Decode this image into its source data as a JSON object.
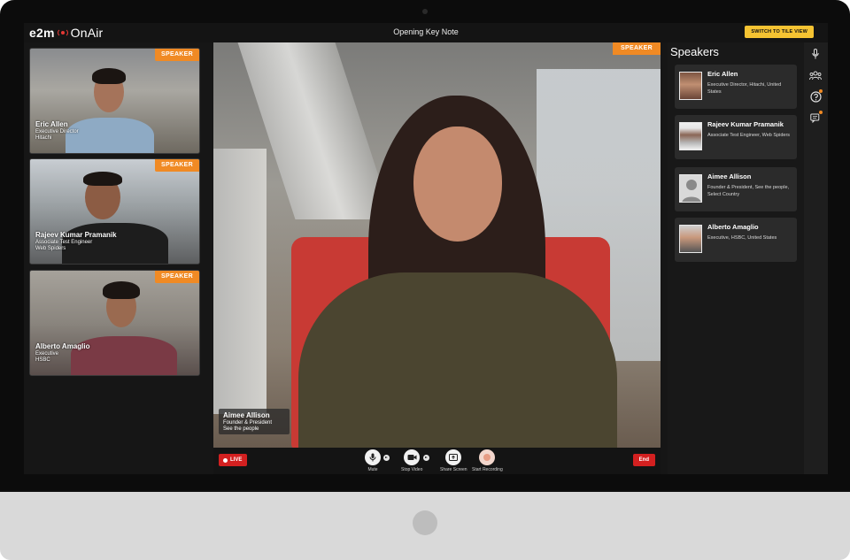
{
  "app": {
    "logo_text": "e2m",
    "logo_suffix": "OnAir",
    "meeting_title": "Opening Key Note",
    "tile_view_button": "SWITCH TO TILE VIEW"
  },
  "tiles": [
    {
      "tag": "SPEAKER",
      "name": "Eric Allen",
      "role": "Executive Director",
      "company": "Hitachi"
    },
    {
      "tag": "SPEAKER",
      "name": "Rajeev Kumar Pramanik",
      "role": "Associate Test Engineer",
      "company": "Web Spiders"
    },
    {
      "tag": "SPEAKER",
      "name": "Alberto Amaglio",
      "role": "Executive",
      "company": "HSBC"
    }
  ],
  "main": {
    "tag": "SPEAKER",
    "name": "Aimee Allison",
    "role": "Founder & President",
    "company": "See the people"
  },
  "controls": {
    "live": "LIVE",
    "mute": "Mute",
    "stop_video": "Stop Video",
    "share_screen": "Share Screen",
    "start_recording": "Start Recording",
    "end": "End"
  },
  "speakers_panel": {
    "title": "Speakers",
    "items": [
      {
        "name": "Eric Allen",
        "detail": "Executive Director, Hitachi, United States"
      },
      {
        "name": "Rajeev Kumar Pramanik",
        "detail": "Associate Test Engineer, Web Spiders"
      },
      {
        "name": "Aimee Allison",
        "detail": "Founder & President, See the people, Select Country"
      },
      {
        "name": "Alberto Amaglio",
        "detail": "Executive, HSBC, United States"
      }
    ]
  },
  "colors": {
    "speaker_tag": "#f08a24",
    "live_red": "#d32020",
    "tile_view_yellow": "#f5c332"
  },
  "icons": [
    "microphone-icon",
    "attendees-icon",
    "help-icon",
    "chat-icon",
    "video-camera-icon",
    "share-screen-icon",
    "record-icon"
  ]
}
